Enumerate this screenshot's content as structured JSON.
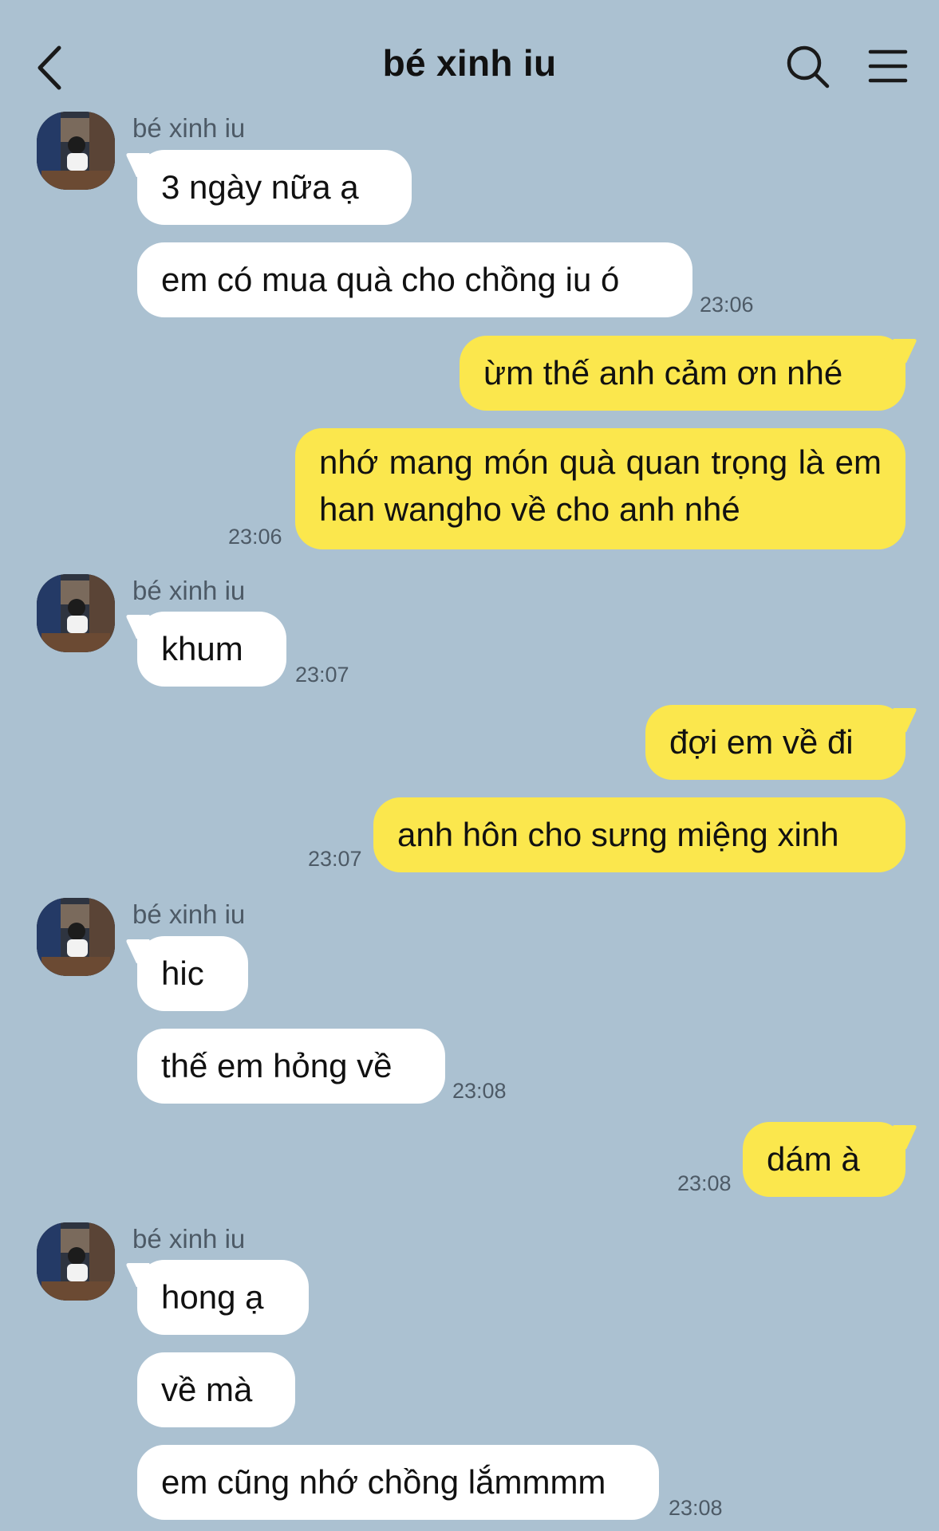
{
  "header": {
    "title": "bé xinh iu",
    "back_icon": "chevron-left-icon",
    "search_icon": "search-icon",
    "menu_icon": "hamburger-menu-icon"
  },
  "colors": {
    "background": "#abc1d1",
    "incoming_bubble": "#ffffff",
    "outgoing_bubble": "#fbe74d",
    "timestamp": "#4d5a66"
  },
  "sender_name": "bé xinh iu",
  "messages": [
    {
      "from": "them",
      "text": "3 ngày nữa ạ"
    },
    {
      "from": "them",
      "text": "em có mua quà cho chồng iu ó",
      "time": "23:06"
    },
    {
      "from": "me",
      "text": "ừm thế anh cảm ơn nhé"
    },
    {
      "from": "me",
      "text": "nhớ mang món quà quan trọng là em han wangho về cho anh nhé",
      "time": "23:06"
    },
    {
      "from": "them",
      "text": "khum",
      "time": "23:07"
    },
    {
      "from": "me",
      "text": "đợi em về đi"
    },
    {
      "from": "me",
      "text": "anh hôn cho sưng miệng xinh",
      "time": "23:07"
    },
    {
      "from": "them",
      "text": "hic"
    },
    {
      "from": "them",
      "text": "thế em hỏng về",
      "time": "23:08"
    },
    {
      "from": "me",
      "text": "dám à",
      "time": "23:08"
    },
    {
      "from": "them",
      "text": "hong ạ"
    },
    {
      "from": "them",
      "text": "về mà"
    },
    {
      "from": "them",
      "text": "em cũng nhớ chồng lắmmmm",
      "time": "23:08"
    }
  ]
}
